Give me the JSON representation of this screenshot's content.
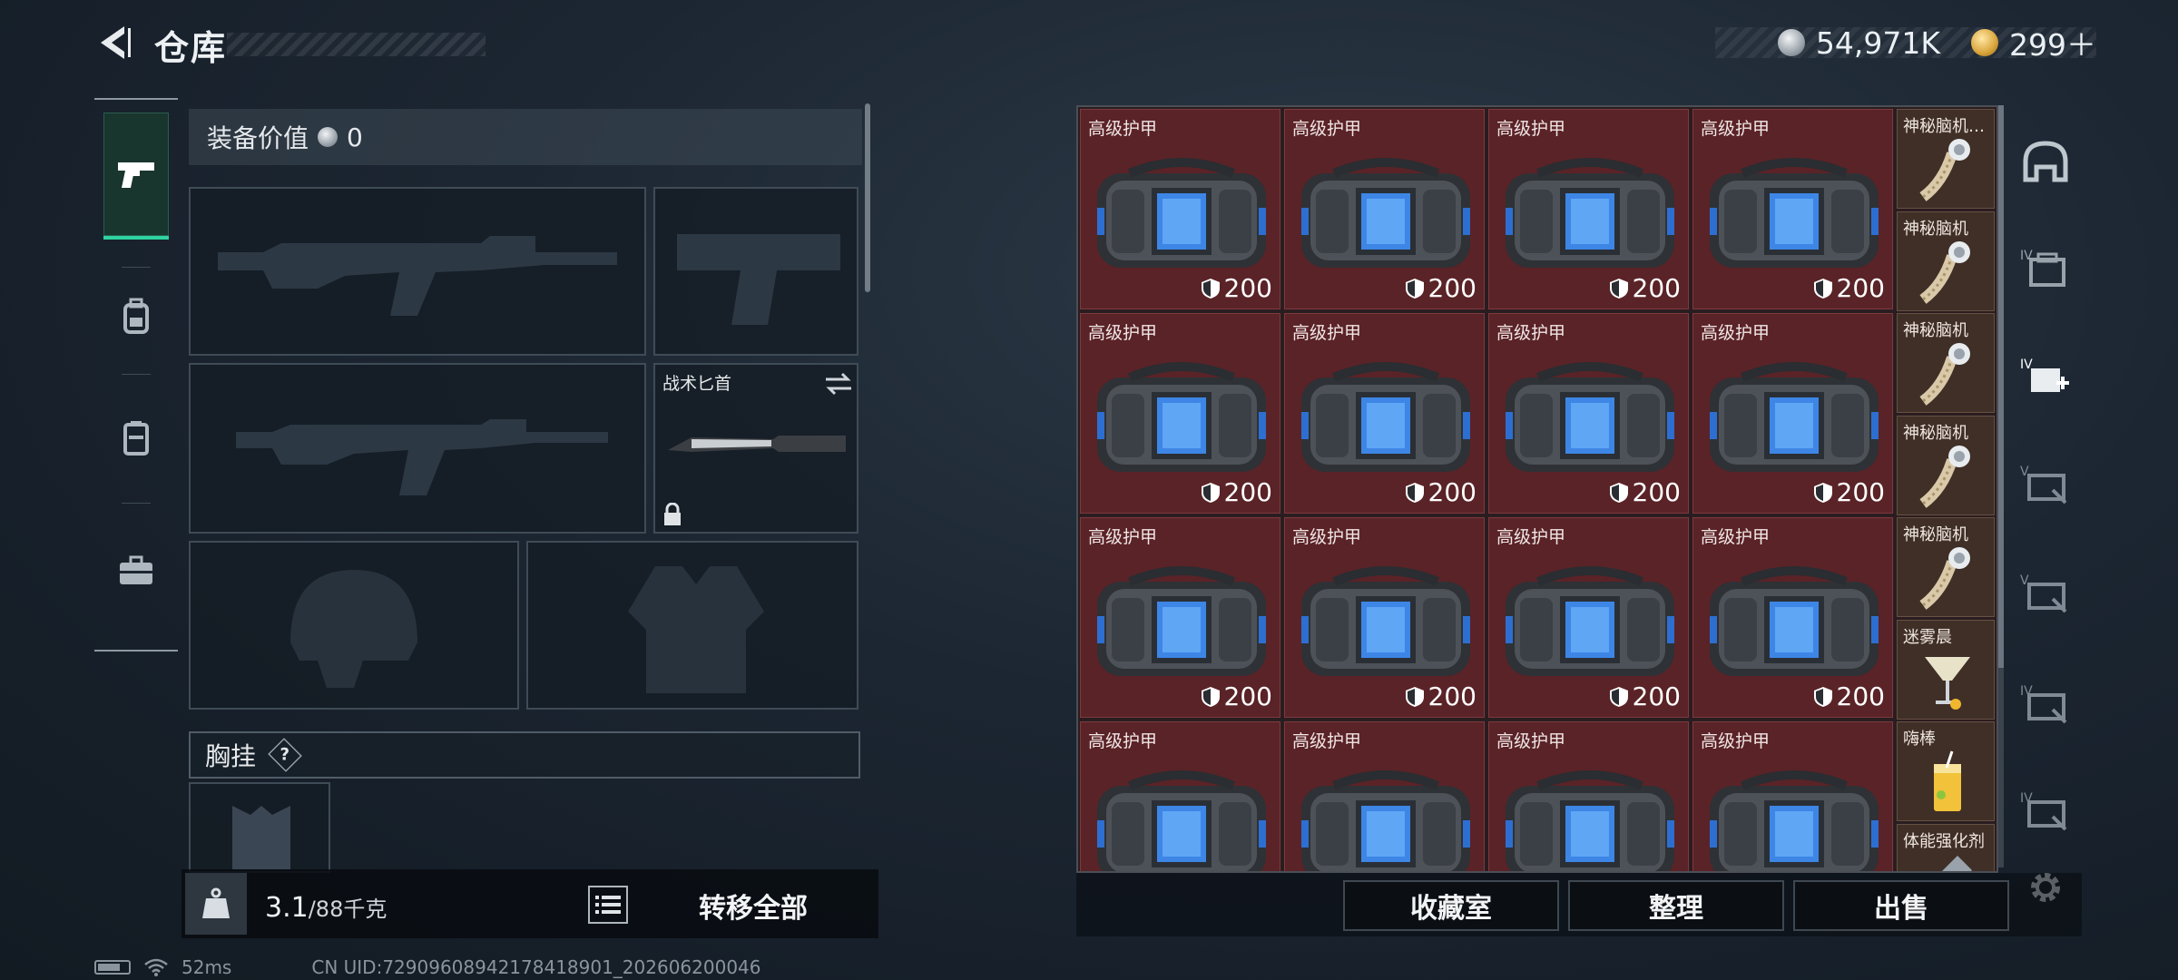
{
  "header": {
    "title": "仓库",
    "currency_silver": "54,971K",
    "currency_gold": "299＋"
  },
  "equipment": {
    "value_label": "装备价值",
    "value": "0",
    "melee_label": "战术匕首",
    "chest_rig_label": "胸挂",
    "chest_rig_help": "?"
  },
  "footer": {
    "weight_current": "3.1",
    "weight_limit": "/88千克",
    "transfer_all": "转移全部",
    "network_ping": "52ms",
    "uid": "CN UID:7290960894217841890​1_202606200046"
  },
  "inventory": {
    "armor_rows": [
      [
        {
          "name": "高级护甲",
          "durability": "200"
        },
        {
          "name": "高级护甲",
          "durability": "200"
        },
        {
          "name": "高级护甲",
          "durability": "200"
        },
        {
          "name": "高级护甲",
          "durability": "200"
        }
      ],
      [
        {
          "name": "高级护甲",
          "durability": "200"
        },
        {
          "name": "高级护甲",
          "durability": "200"
        },
        {
          "name": "高级护甲",
          "durability": "200"
        },
        {
          "name": "高级护甲",
          "durability": "200"
        }
      ],
      [
        {
          "name": "高级护甲",
          "durability": "200"
        },
        {
          "name": "高级护甲",
          "durability": "200"
        },
        {
          "name": "高级护甲",
          "durability": "200"
        },
        {
          "name": "高级护甲",
          "durability": "200"
        }
      ],
      [
        {
          "name": "高级护甲"
        },
        {
          "name": "高级护甲"
        },
        {
          "name": "高级护甲"
        },
        {
          "name": "高级护甲"
        }
      ]
    ],
    "side_items": [
      "神秘脑机…",
      "神秘脑机",
      "神秘脑机",
      "神秘脑机",
      "神秘脑机",
      "迷雾晨",
      "嗨棒",
      "体能强化剂"
    ]
  },
  "actions": {
    "collection": "收藏室",
    "organize": "整理",
    "sell": "出售"
  },
  "colors": {
    "accent": "#2fd3a0",
    "armor_cell": "#5a2327",
    "item_cell": "#3f2f27"
  }
}
